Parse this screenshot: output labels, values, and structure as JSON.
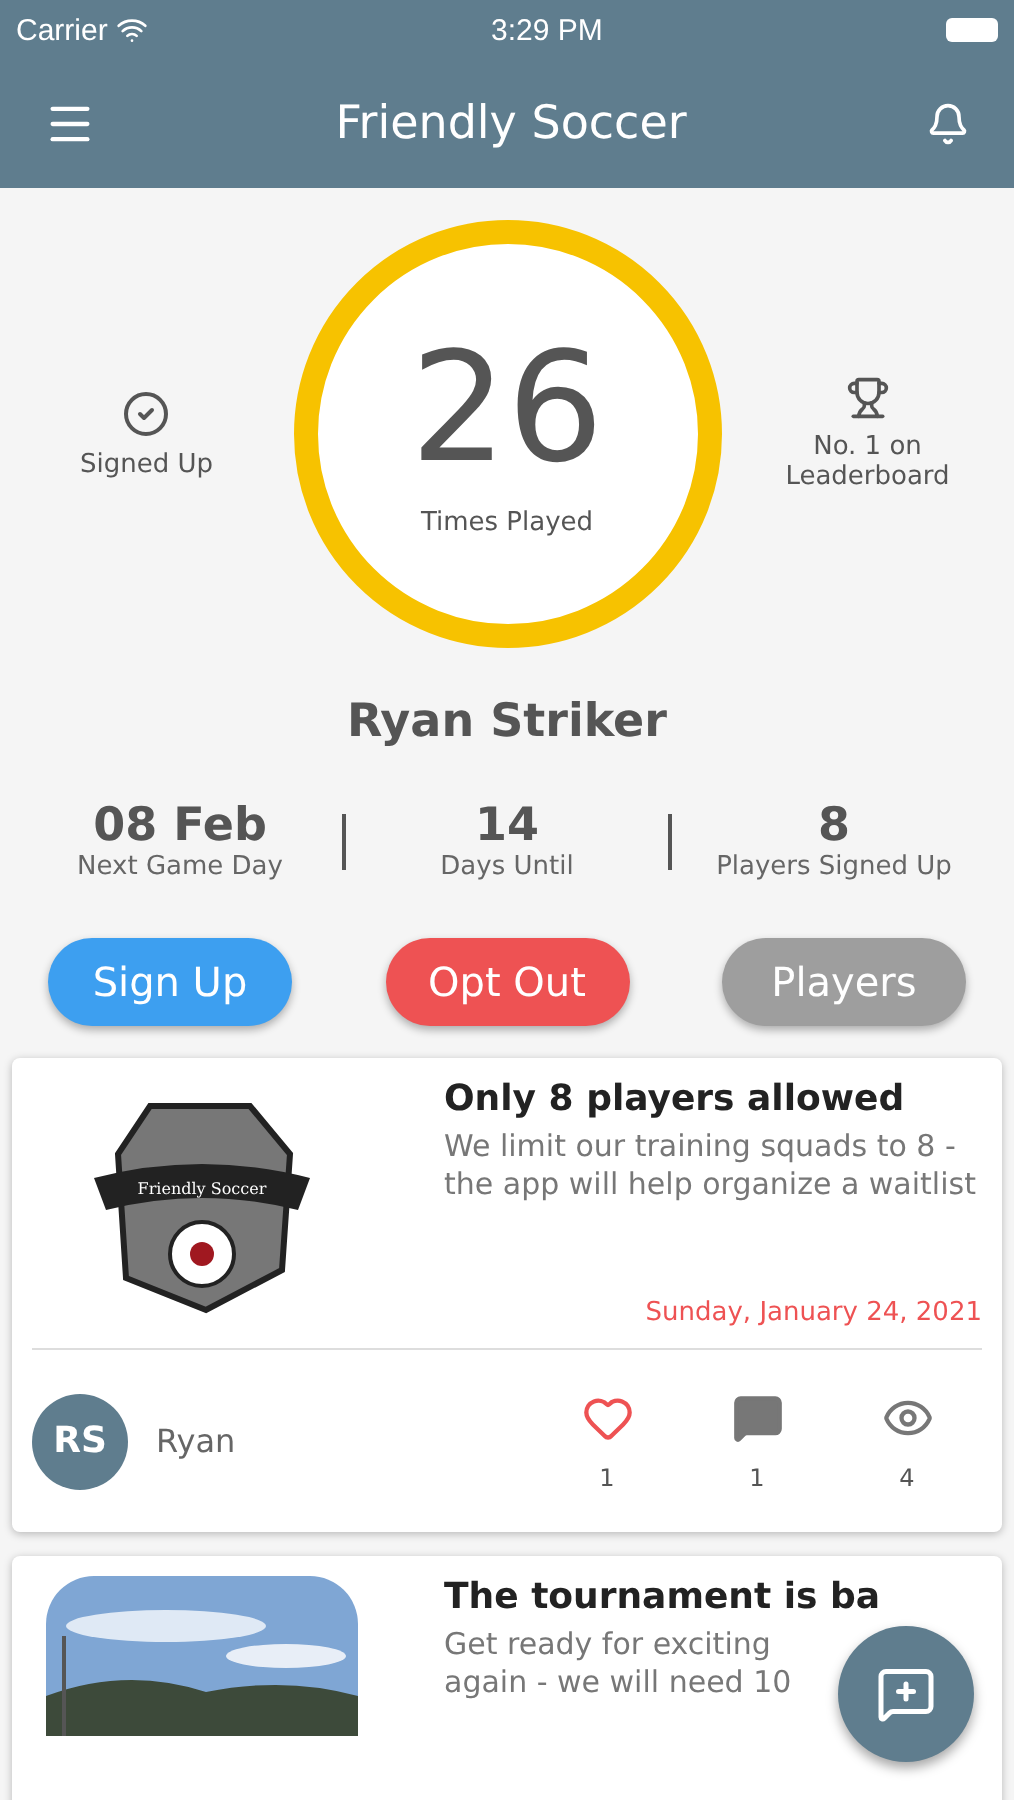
{
  "status_bar": {
    "carrier": "Carrier",
    "time": "3:29 PM"
  },
  "header": {
    "title": "Friendly Soccer"
  },
  "summary": {
    "left": {
      "label": "Signed Up"
    },
    "count": "26",
    "count_label": "Times Played",
    "right": {
      "label": "No. 1 on Leaderboard"
    }
  },
  "player": {
    "name": "Ryan Striker"
  },
  "stats": [
    {
      "value": "08 Feb",
      "label": "Next Game Day"
    },
    {
      "value": "14",
      "label": "Days Until"
    },
    {
      "value": "8",
      "label": "Players Signed Up"
    }
  ],
  "buttons": [
    {
      "label": "Sign Up",
      "color": "#3d9ff0"
    },
    {
      "label": "Opt Out",
      "color": "#ee5253"
    },
    {
      "label": "Players",
      "color": "#9e9e9e"
    }
  ],
  "posts": [
    {
      "kind": "logo",
      "logo_text": "Friendly Soccer",
      "title": "Only 8 players allowed",
      "body": "We limit our training squads to 8 - the app will help organize a waitlist",
      "date": "Sunday, January 24, 2021",
      "author_initials": "RS",
      "author": "Ryan",
      "likes": "1",
      "comments": "1",
      "views": "4"
    },
    {
      "kind": "picture",
      "title": "The tournament is ba",
      "body_lines": [
        "Get ready for exciting",
        "again - we will need 10"
      ]
    }
  ]
}
